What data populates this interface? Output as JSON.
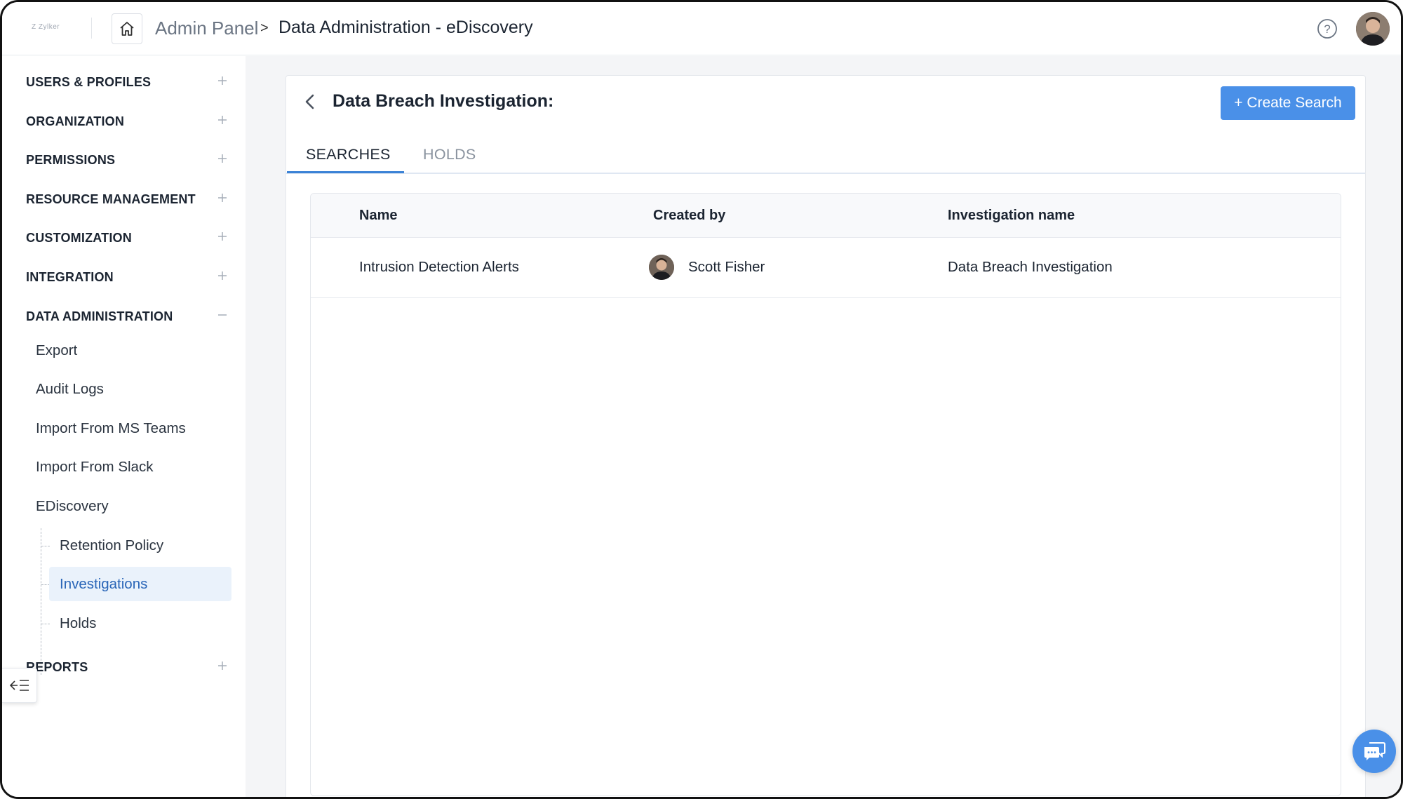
{
  "header": {
    "logo_text": "Z Zylker",
    "breadcrumb_root": "Admin Panel",
    "breadcrumb_separator": ">",
    "breadcrumb_current": "Data Administration - eDiscovery"
  },
  "sidebar": {
    "sections": [
      {
        "label": "USERS & PROFILES",
        "toggle": "+"
      },
      {
        "label": "ORGANIZATION",
        "toggle": "+"
      },
      {
        "label": "PERMISSIONS",
        "toggle": "+"
      },
      {
        "label": "RESOURCE MANAGEMENT",
        "toggle": "+"
      },
      {
        "label": "CUSTOMIZATION",
        "toggle": "+"
      },
      {
        "label": "INTEGRATION",
        "toggle": "+"
      },
      {
        "label": "DATA ADMINISTRATION",
        "toggle": "−"
      },
      {
        "label": "REPORTS",
        "toggle": "+"
      }
    ],
    "data_admin_items": [
      "Export",
      "Audit Logs",
      "Import From MS Teams",
      "Import From Slack",
      "EDiscovery"
    ],
    "ediscovery_items": [
      "Retention Policy",
      "Investigations",
      "Holds"
    ],
    "active_item": "Investigations"
  },
  "main": {
    "title": "Data Breach Investigation:",
    "create_button": "+ Create Search",
    "tabs": [
      {
        "label": "SEARCHES",
        "active": true
      },
      {
        "label": "HOLDS",
        "active": false
      }
    ],
    "table": {
      "columns": [
        "Name",
        "Created by",
        "Investigation name"
      ],
      "rows": [
        {
          "name": "Intrusion Detection Alerts",
          "created_by": "Scott Fisher",
          "investigation": "Data Breach Investigation"
        }
      ]
    }
  },
  "colors": {
    "accent": "#4a90e8",
    "active_bg": "#eaf2fb",
    "active_text": "#2a66b8",
    "tab_underline": "#3b82d6"
  },
  "icons": {
    "home": "home-icon",
    "help": "help-circle-icon",
    "back": "chevron-left-icon",
    "collapse": "collapse-sidebar-icon",
    "chat": "chat-icon"
  }
}
